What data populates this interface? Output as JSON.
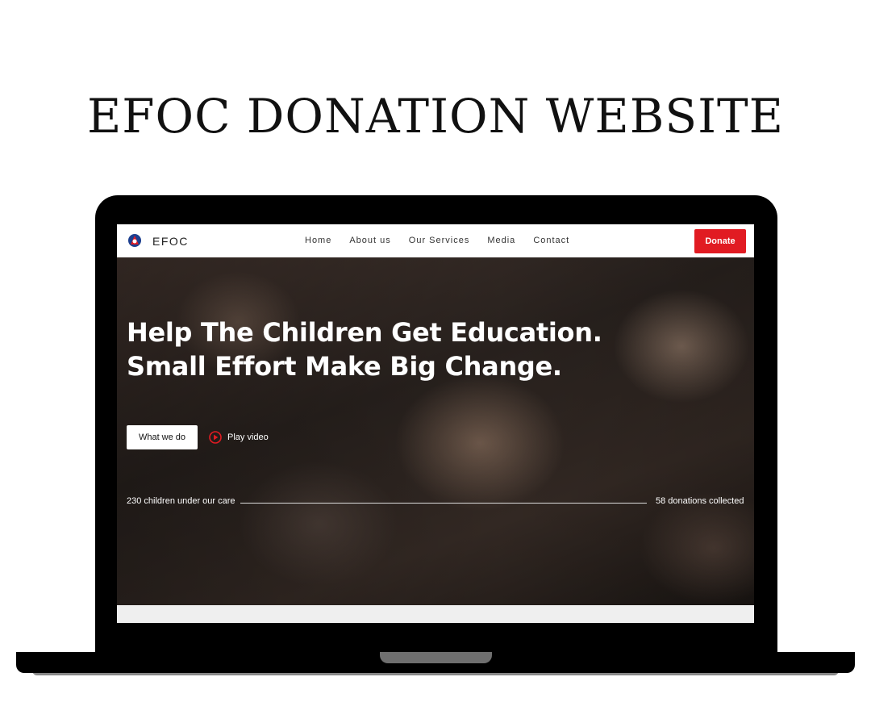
{
  "page": {
    "title": "EFOC DONATION WEBSITE"
  },
  "navbar": {
    "brand": "EFOC",
    "links": [
      "Home",
      "About us",
      "Our Services",
      "Media",
      "Contact"
    ],
    "donate_label": "Donate"
  },
  "hero": {
    "headline_line1": "Help The Children Get Education.",
    "headline_line2": "Small Effort Make Big Change.",
    "primary_button": "What we do",
    "secondary_button": "Play video",
    "stat_left": "230 children under our care",
    "stat_right": "58 donations collected"
  },
  "colors": {
    "accent": "#e11b22",
    "text_dark": "#111111",
    "navbar_bg": "#ffffff"
  }
}
